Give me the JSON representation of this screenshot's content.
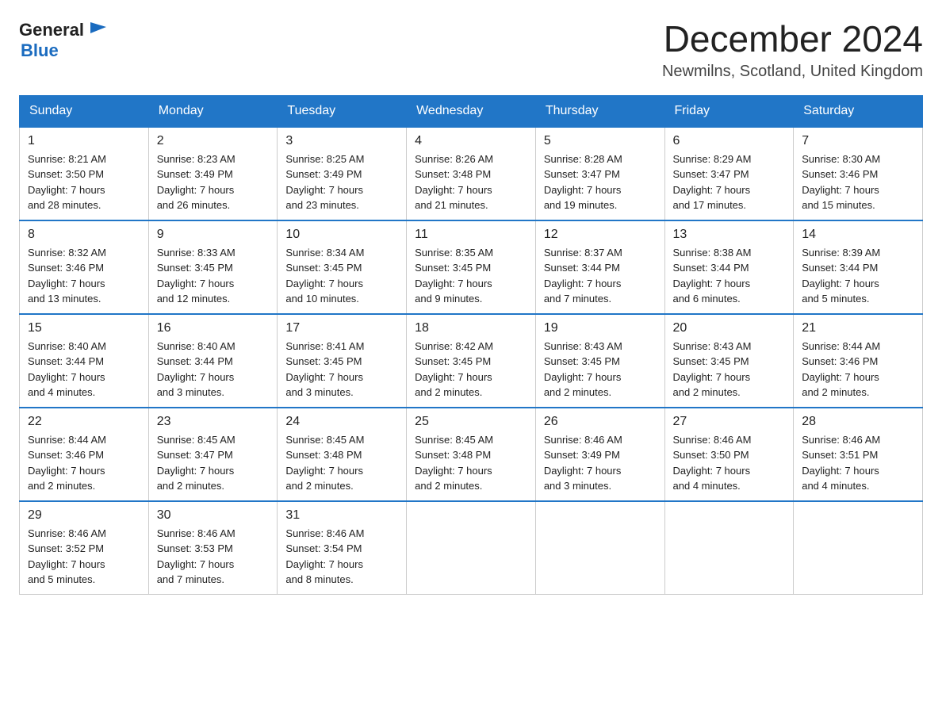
{
  "header": {
    "logo_general": "General",
    "logo_blue": "Blue",
    "month_title": "December 2024",
    "location": "Newmilns, Scotland, United Kingdom"
  },
  "weekdays": [
    "Sunday",
    "Monday",
    "Tuesday",
    "Wednesday",
    "Thursday",
    "Friday",
    "Saturday"
  ],
  "weeks": [
    [
      {
        "day": "1",
        "sunrise": "8:21 AM",
        "sunset": "3:50 PM",
        "daylight": "7 hours and 28 minutes."
      },
      {
        "day": "2",
        "sunrise": "8:23 AM",
        "sunset": "3:49 PM",
        "daylight": "7 hours and 26 minutes."
      },
      {
        "day": "3",
        "sunrise": "8:25 AM",
        "sunset": "3:49 PM",
        "daylight": "7 hours and 23 minutes."
      },
      {
        "day": "4",
        "sunrise": "8:26 AM",
        "sunset": "3:48 PM",
        "daylight": "7 hours and 21 minutes."
      },
      {
        "day": "5",
        "sunrise": "8:28 AM",
        "sunset": "3:47 PM",
        "daylight": "7 hours and 19 minutes."
      },
      {
        "day": "6",
        "sunrise": "8:29 AM",
        "sunset": "3:47 PM",
        "daylight": "7 hours and 17 minutes."
      },
      {
        "day": "7",
        "sunrise": "8:30 AM",
        "sunset": "3:46 PM",
        "daylight": "7 hours and 15 minutes."
      }
    ],
    [
      {
        "day": "8",
        "sunrise": "8:32 AM",
        "sunset": "3:46 PM",
        "daylight": "7 hours and 13 minutes."
      },
      {
        "day": "9",
        "sunrise": "8:33 AM",
        "sunset": "3:45 PM",
        "daylight": "7 hours and 12 minutes."
      },
      {
        "day": "10",
        "sunrise": "8:34 AM",
        "sunset": "3:45 PM",
        "daylight": "7 hours and 10 minutes."
      },
      {
        "day": "11",
        "sunrise": "8:35 AM",
        "sunset": "3:45 PM",
        "daylight": "7 hours and 9 minutes."
      },
      {
        "day": "12",
        "sunrise": "8:37 AM",
        "sunset": "3:44 PM",
        "daylight": "7 hours and 7 minutes."
      },
      {
        "day": "13",
        "sunrise": "8:38 AM",
        "sunset": "3:44 PM",
        "daylight": "7 hours and 6 minutes."
      },
      {
        "day": "14",
        "sunrise": "8:39 AM",
        "sunset": "3:44 PM",
        "daylight": "7 hours and 5 minutes."
      }
    ],
    [
      {
        "day": "15",
        "sunrise": "8:40 AM",
        "sunset": "3:44 PM",
        "daylight": "7 hours and 4 minutes."
      },
      {
        "day": "16",
        "sunrise": "8:40 AM",
        "sunset": "3:44 PM",
        "daylight": "7 hours and 3 minutes."
      },
      {
        "day": "17",
        "sunrise": "8:41 AM",
        "sunset": "3:45 PM",
        "daylight": "7 hours and 3 minutes."
      },
      {
        "day": "18",
        "sunrise": "8:42 AM",
        "sunset": "3:45 PM",
        "daylight": "7 hours and 2 minutes."
      },
      {
        "day": "19",
        "sunrise": "8:43 AM",
        "sunset": "3:45 PM",
        "daylight": "7 hours and 2 minutes."
      },
      {
        "day": "20",
        "sunrise": "8:43 AM",
        "sunset": "3:45 PM",
        "daylight": "7 hours and 2 minutes."
      },
      {
        "day": "21",
        "sunrise": "8:44 AM",
        "sunset": "3:46 PM",
        "daylight": "7 hours and 2 minutes."
      }
    ],
    [
      {
        "day": "22",
        "sunrise": "8:44 AM",
        "sunset": "3:46 PM",
        "daylight": "7 hours and 2 minutes."
      },
      {
        "day": "23",
        "sunrise": "8:45 AM",
        "sunset": "3:47 PM",
        "daylight": "7 hours and 2 minutes."
      },
      {
        "day": "24",
        "sunrise": "8:45 AM",
        "sunset": "3:48 PM",
        "daylight": "7 hours and 2 minutes."
      },
      {
        "day": "25",
        "sunrise": "8:45 AM",
        "sunset": "3:48 PM",
        "daylight": "7 hours and 2 minutes."
      },
      {
        "day": "26",
        "sunrise": "8:46 AM",
        "sunset": "3:49 PM",
        "daylight": "7 hours and 3 minutes."
      },
      {
        "day": "27",
        "sunrise": "8:46 AM",
        "sunset": "3:50 PM",
        "daylight": "7 hours and 4 minutes."
      },
      {
        "day": "28",
        "sunrise": "8:46 AM",
        "sunset": "3:51 PM",
        "daylight": "7 hours and 4 minutes."
      }
    ],
    [
      {
        "day": "29",
        "sunrise": "8:46 AM",
        "sunset": "3:52 PM",
        "daylight": "7 hours and 5 minutes."
      },
      {
        "day": "30",
        "sunrise": "8:46 AM",
        "sunset": "3:53 PM",
        "daylight": "7 hours and 7 minutes."
      },
      {
        "day": "31",
        "sunrise": "8:46 AM",
        "sunset": "3:54 PM",
        "daylight": "7 hours and 8 minutes."
      },
      null,
      null,
      null,
      null
    ]
  ],
  "labels": {
    "sunrise": "Sunrise:",
    "sunset": "Sunset:",
    "daylight": "Daylight:"
  }
}
